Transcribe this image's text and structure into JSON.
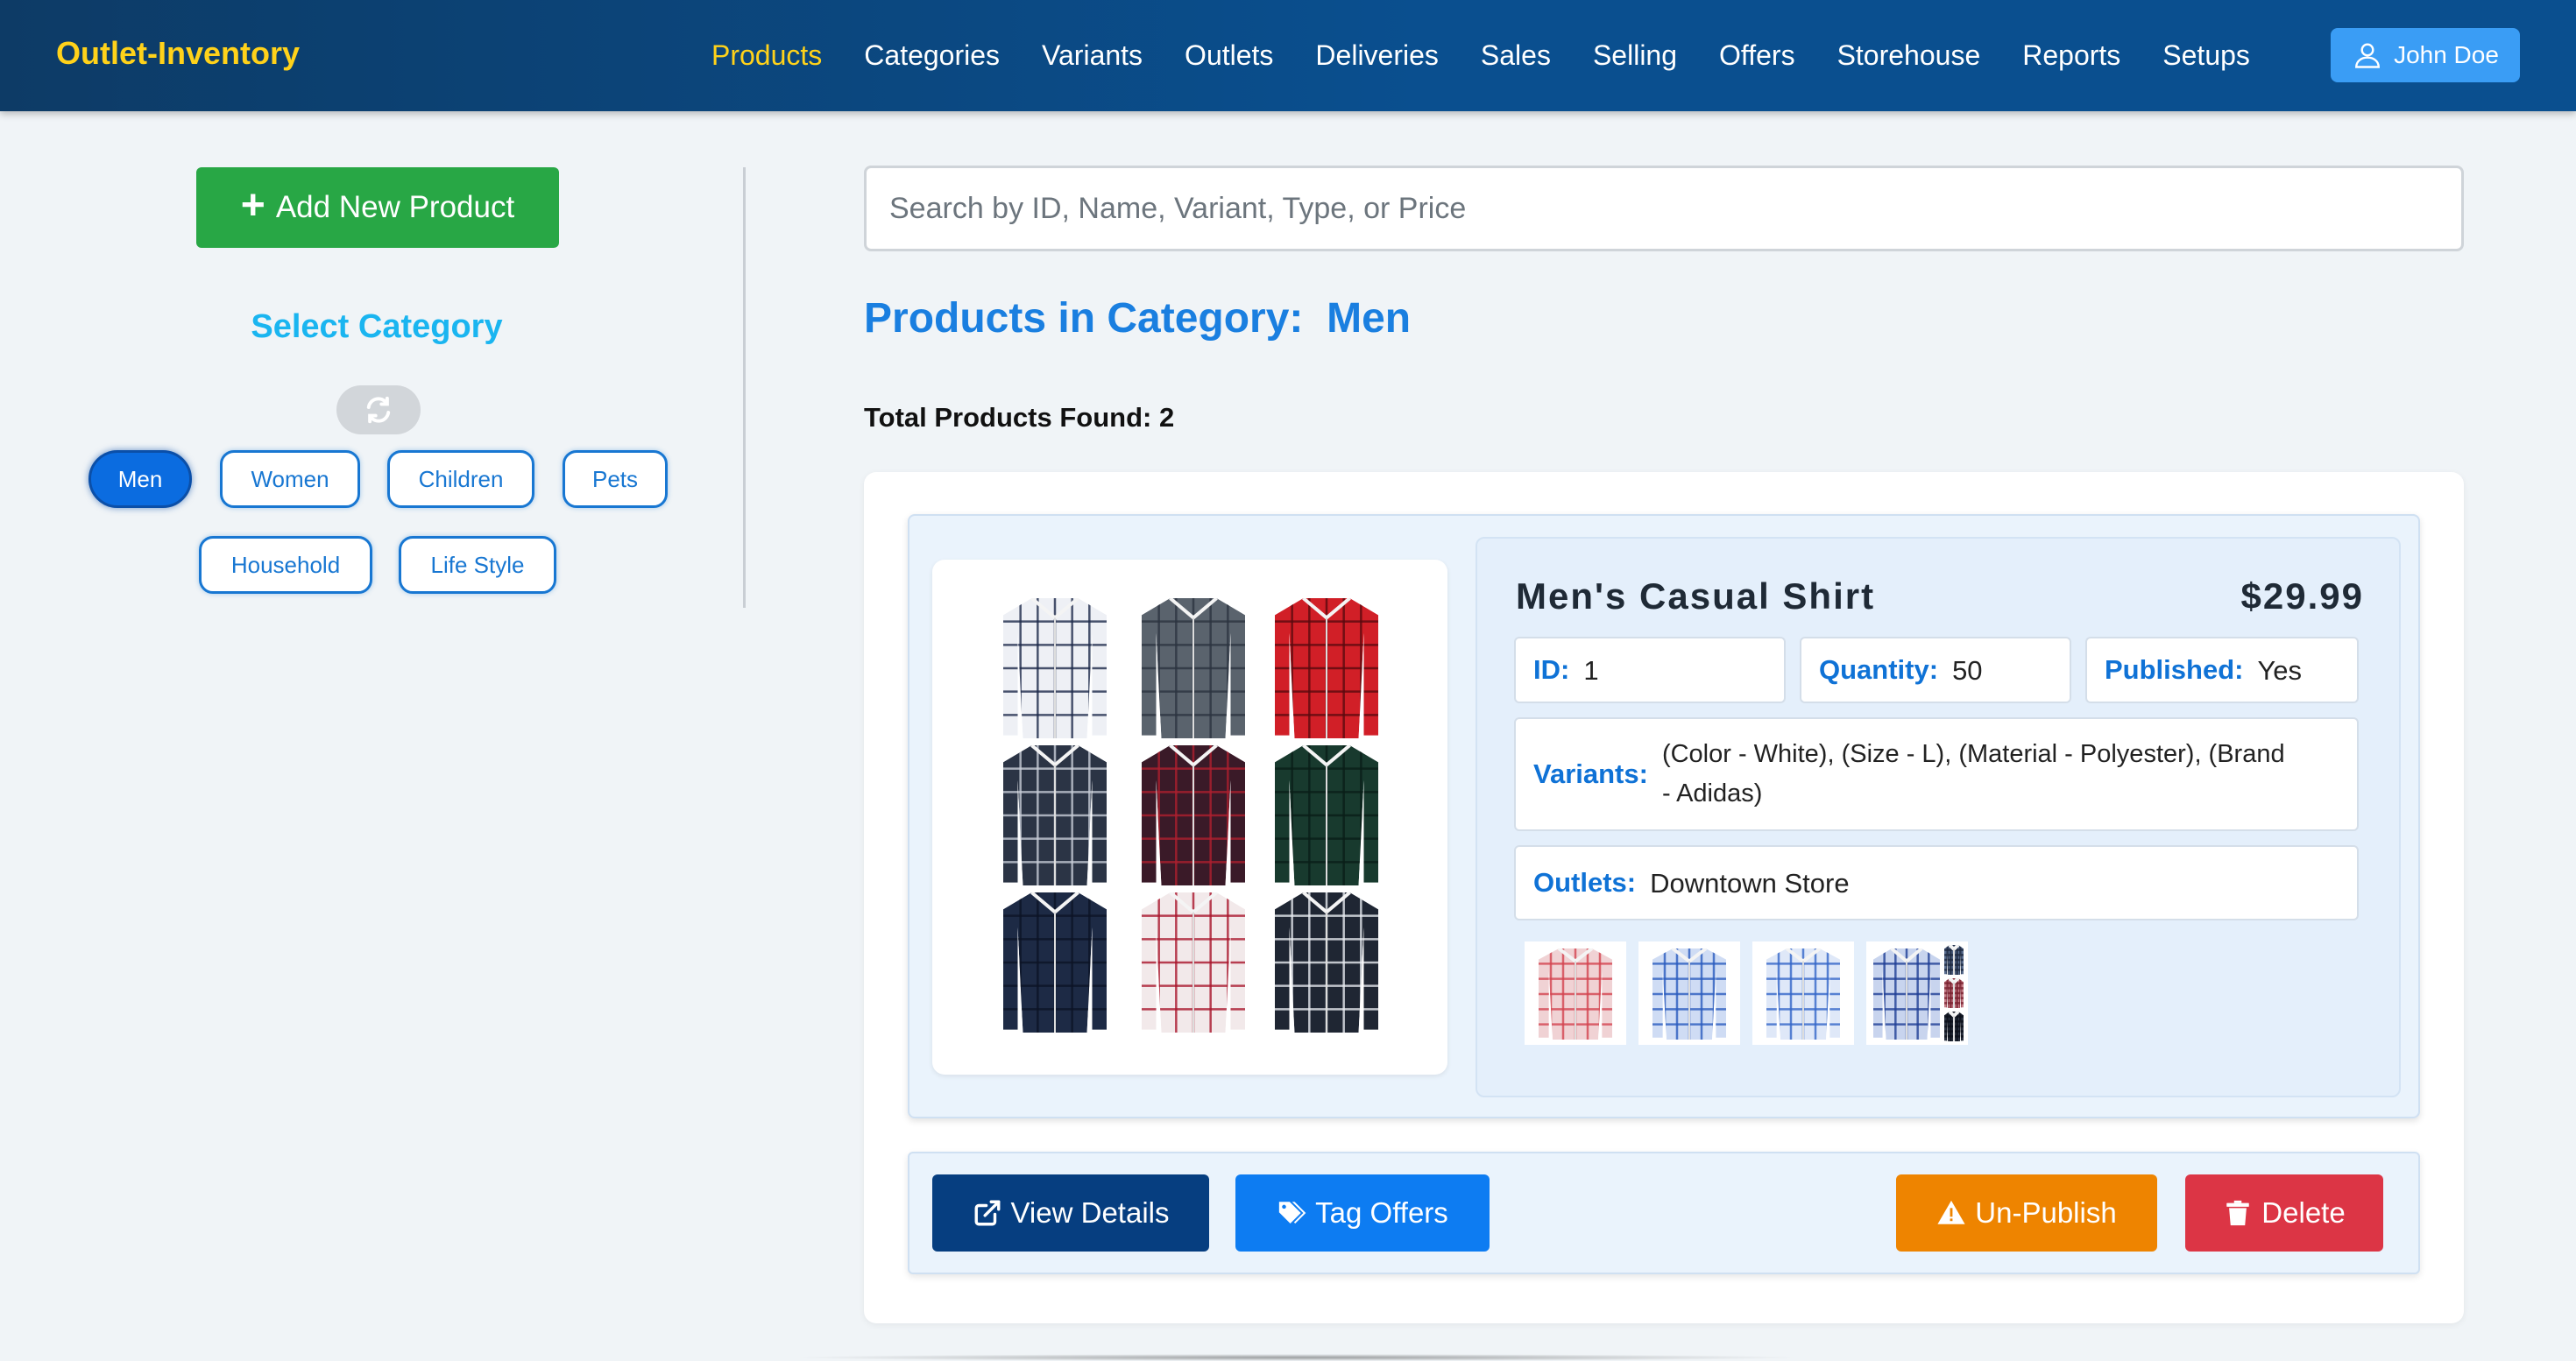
{
  "app": {
    "brand": "Outlet-Inventory"
  },
  "nav": {
    "items": [
      "Products",
      "Categories",
      "Variants",
      "Outlets",
      "Deliveries",
      "Sales",
      "Selling",
      "Offers",
      "Storehouse",
      "Reports",
      "Setups"
    ],
    "active": "Products",
    "user": "John Doe"
  },
  "sidebar": {
    "add_product_label": "Add New Product",
    "select_category_title": "Select Category",
    "categories": [
      "Men",
      "Women",
      "Children",
      "Pets",
      "Household",
      "Life Style"
    ],
    "selected_category": "Men"
  },
  "search": {
    "placeholder": "Search by ID, Name, Variant, Type, or Price",
    "value": ""
  },
  "main": {
    "heading_prefix": "Products in Category:",
    "heading_category": "Men",
    "total_label": "Total Products Found:",
    "total_count": "2"
  },
  "product": {
    "name": "Men's Casual Shirt",
    "price": "$29.99",
    "id_label": "ID:",
    "id": "1",
    "quantity_label": "Quantity:",
    "quantity": "50",
    "published_label": "Published:",
    "published": "Yes",
    "variants_label": "Variants:",
    "variants": "(Color - White), (Size - L), (Material - Polyester), (Brand - Adidas)",
    "outlets_label": "Outlets:",
    "outlets": "Downtown Store"
  },
  "actions": {
    "view_details": "View Details",
    "tag_offers": "Tag Offers",
    "unpublish": "Un-Publish",
    "delete": "Delete"
  },
  "colors": {
    "nav_bg": "#0a4f8f",
    "brand": "#ffd21a",
    "add_button": "#28a745",
    "accent_blue": "#1a7fe0",
    "view_details": "#063e80",
    "tag_offers": "#0d7cf2",
    "unpublish": "#ee8400",
    "delete": "#dc3545"
  }
}
